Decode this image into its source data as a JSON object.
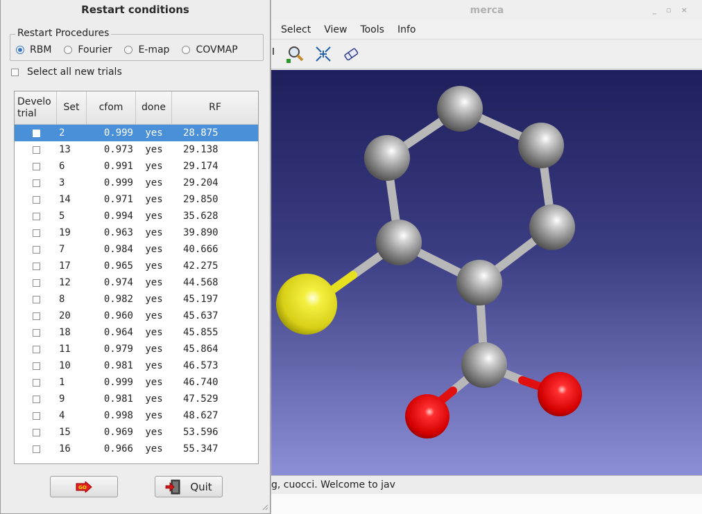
{
  "background_window": {
    "title": "merca",
    "menu": [
      "Select",
      "View",
      "Tools",
      "Info"
    ],
    "toolbar_icons": [
      "partial-icon",
      "zoom-icon",
      "fit-icon",
      "eraser-icon"
    ],
    "status_text": "g, cuocci.  Welcome to jav"
  },
  "dialog": {
    "title": "Restart conditions",
    "group_label": "Restart Procedures",
    "radios": [
      {
        "label": "RBM",
        "selected": true
      },
      {
        "label": "Fourier",
        "selected": false
      },
      {
        "label": "E-map",
        "selected": false
      },
      {
        "label": "COVMAP",
        "selected": false
      }
    ],
    "select_all_label": "Select all new trials",
    "columns": [
      "Develo\ntrial",
      "Set",
      "cfom",
      "done",
      "RF"
    ],
    "rows": [
      {
        "set": "2",
        "cfom": "0.999",
        "done": "yes",
        "rf": "28.875",
        "selected": true
      },
      {
        "set": "13",
        "cfom": "0.973",
        "done": "yes",
        "rf": "29.138"
      },
      {
        "set": "6",
        "cfom": "0.991",
        "done": "yes",
        "rf": "29.174"
      },
      {
        "set": "3",
        "cfom": "0.999",
        "done": "yes",
        "rf": "29.204"
      },
      {
        "set": "14",
        "cfom": "0.971",
        "done": "yes",
        "rf": "29.850"
      },
      {
        "set": "5",
        "cfom": "0.994",
        "done": "yes",
        "rf": "35.628"
      },
      {
        "set": "19",
        "cfom": "0.963",
        "done": "yes",
        "rf": "39.890"
      },
      {
        "set": "7",
        "cfom": "0.984",
        "done": "yes",
        "rf": "40.666"
      },
      {
        "set": "17",
        "cfom": "0.965",
        "done": "yes",
        "rf": "42.275"
      },
      {
        "set": "12",
        "cfom": "0.974",
        "done": "yes",
        "rf": "44.568"
      },
      {
        "set": "8",
        "cfom": "0.982",
        "done": "yes",
        "rf": "45.197"
      },
      {
        "set": "20",
        "cfom": "0.960",
        "done": "yes",
        "rf": "45.637"
      },
      {
        "set": "18",
        "cfom": "0.964",
        "done": "yes",
        "rf": "45.855"
      },
      {
        "set": "11",
        "cfom": "0.979",
        "done": "yes",
        "rf": "45.864"
      },
      {
        "set": "10",
        "cfom": "0.981",
        "done": "yes",
        "rf": "46.573"
      },
      {
        "set": "1",
        "cfom": "0.999",
        "done": "yes",
        "rf": "46.740"
      },
      {
        "set": "9",
        "cfom": "0.981",
        "done": "yes",
        "rf": "47.529"
      },
      {
        "set": "4",
        "cfom": "0.998",
        "done": "yes",
        "rf": "48.627"
      },
      {
        "set": "15",
        "cfom": "0.969",
        "done": "yes",
        "rf": "53.596"
      },
      {
        "set": "16",
        "cfom": "0.966",
        "done": "yes",
        "rf": "55.347"
      }
    ],
    "go_icon_text": "GO",
    "quit_label": "Quit"
  },
  "colors": {
    "selection": "#4a90d9",
    "carbon": "#8a8a8a",
    "oxygen": "#e01010",
    "sulfur": "#e8e020"
  }
}
